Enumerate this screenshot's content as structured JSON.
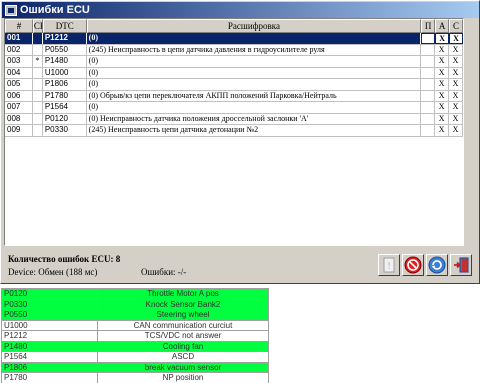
{
  "window": {
    "title": "Ошибки ECU"
  },
  "table": {
    "headers": {
      "num": "#",
      "ck": "CK",
      "dtc": "DTC",
      "desc": "Расшифровка",
      "p": "П",
      "a": "A",
      "c": "C"
    },
    "rows": [
      {
        "num": "001",
        "ck": "",
        "dtc": "P1212",
        "desc": "(0)",
        "p": "",
        "a": "X",
        "c": "X",
        "selected": true
      },
      {
        "num": "002",
        "ck": "",
        "dtc": "P0550",
        "desc": "(245) Неисправность в цепи датчика давления в гидроусилителе руля",
        "p": "",
        "a": "X",
        "c": "X"
      },
      {
        "num": "003",
        "ck": "*",
        "dtc": "P1480",
        "desc": "(0)",
        "p": "",
        "a": "X",
        "c": "X"
      },
      {
        "num": "004",
        "ck": "",
        "dtc": "U1000",
        "desc": "(0)",
        "p": "",
        "a": "X",
        "c": "X"
      },
      {
        "num": "005",
        "ck": "",
        "dtc": "P1806",
        "desc": "(0)",
        "p": "",
        "a": "X",
        "c": "X"
      },
      {
        "num": "006",
        "ck": "",
        "dtc": "P1780",
        "desc": "(0) Обрыв/кз цепи переключателя АКПП положений Парковка/Нейтраль",
        "p": "",
        "a": "X",
        "c": "X"
      },
      {
        "num": "007",
        "ck": "",
        "dtc": "P1564",
        "desc": "(0)",
        "p": "",
        "a": "X",
        "c": "X"
      },
      {
        "num": "008",
        "ck": "",
        "dtc": "P0120",
        "desc": "(0) Неисправность датчика положения дроссельной заслонки 'A'",
        "p": "",
        "a": "X",
        "c": "X"
      },
      {
        "num": "009",
        "ck": "",
        "dtc": "P0330",
        "desc": "(245) Неисправность цепи датчика детонации №2",
        "p": "",
        "a": "X",
        "c": "X"
      }
    ]
  },
  "status": {
    "error_count": "Количество ошибок ECU: 8",
    "device": "Device:  Обмен (188 мс)",
    "errors": "Ошибки: -/-"
  },
  "toolbar": {
    "buttons": [
      {
        "name": "info-button",
        "icon": "info-icon"
      },
      {
        "name": "stop-button",
        "icon": "no-entry-icon"
      },
      {
        "name": "refresh-button",
        "icon": "refresh-icon"
      },
      {
        "name": "exit-button",
        "icon": "exit-door-icon"
      }
    ]
  },
  "colors": {
    "selection": "#0a246a",
    "highlight_green": "#00ff3f"
  },
  "code_table": [
    {
      "code": "P0120",
      "name": "Throttle Motor A pos",
      "highlight": true
    },
    {
      "code": "P0330",
      "name": "Knock Sensor Bank2",
      "highlight": true
    },
    {
      "code": "P0550",
      "name": "Steering wheel",
      "highlight": true
    },
    {
      "code": "U1000",
      "name": "CAN communication curciut",
      "highlight": false
    },
    {
      "code": "P1212",
      "name": "TCS/VDC not answer",
      "highlight": false
    },
    {
      "code": "P1480",
      "name": "Cooling fan",
      "highlight": true
    },
    {
      "code": "P1564",
      "name": "ASCD",
      "highlight": false
    },
    {
      "code": "P1806",
      "name": "break vacuum sensor",
      "highlight": true
    },
    {
      "code": "P1780",
      "name": "NP position",
      "highlight": false
    }
  ]
}
